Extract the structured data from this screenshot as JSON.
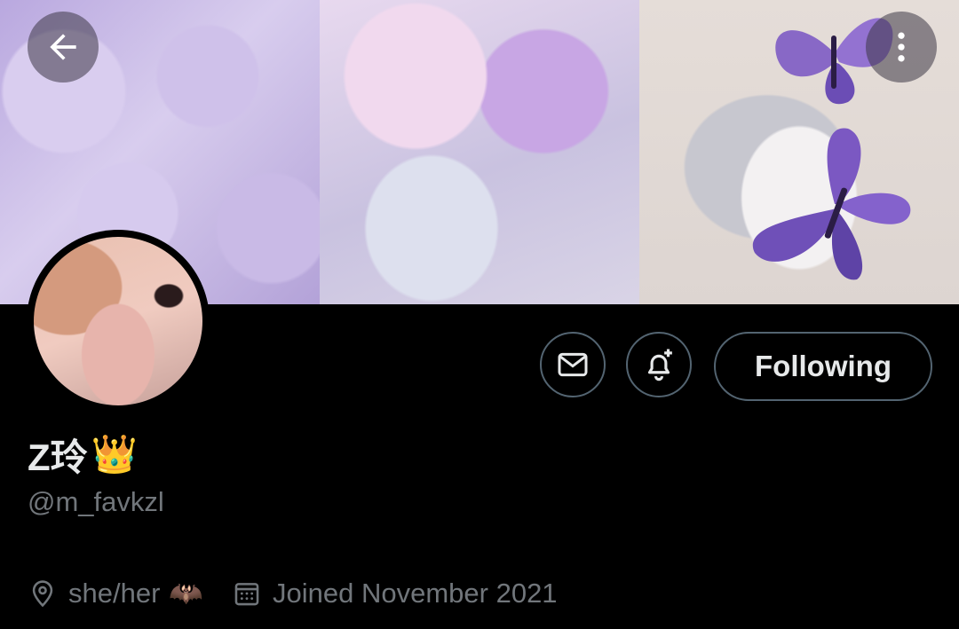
{
  "header": {
    "back_icon": "arrow-left-icon",
    "more_icon": "more-vertical-icon"
  },
  "banner": {
    "panels": [
      "lavender-sugar-cubes",
      "resin-heart-ornaments",
      "purple-butterflies-shell"
    ]
  },
  "actions": {
    "message_icon": "mail-icon",
    "notify_icon": "bell-plus-icon",
    "follow_label": "Following"
  },
  "profile": {
    "display_name": "Z玲",
    "display_name_emoji": "👑",
    "handle": "@m_favkzl",
    "pronouns": "she/her",
    "pronouns_emoji": "🦇",
    "joined": "Joined November 2021"
  },
  "colors": {
    "background": "#000000",
    "text_primary": "#e7e9ea",
    "text_secondary": "#71767b",
    "border": "#536471"
  }
}
